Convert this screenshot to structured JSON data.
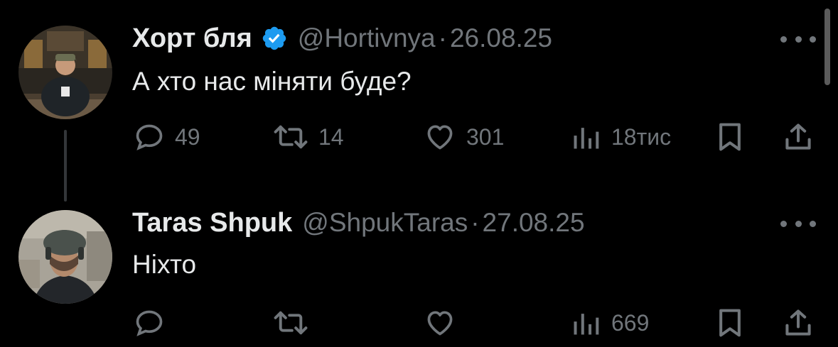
{
  "tweets": [
    {
      "display_name": "Хорт бля",
      "verified": true,
      "handle": "@Hortivnya",
      "separator": "·",
      "date": "26.08.25",
      "text": "А хто нас міняти буде?",
      "actions": {
        "replies": "49",
        "retweets": "14",
        "likes": "301",
        "views": "18тис"
      }
    },
    {
      "display_name": "Taras Shpuk",
      "verified": false,
      "handle": "@ShpukTaras",
      "separator": "·",
      "date": "27.08.25",
      "text": "Ніхто",
      "actions": {
        "replies": "",
        "retweets": "",
        "likes": "",
        "views": "669"
      }
    }
  ],
  "icons": {
    "reply": "reply-icon",
    "retweet": "retweet-icon",
    "like": "heart-icon",
    "views": "views-icon",
    "bookmark": "bookmark-icon",
    "share": "share-icon",
    "more": "more-icon",
    "verified": "verified-badge-icon"
  },
  "colors": {
    "background": "#000000",
    "primary_text": "#e7e9ea",
    "secondary_text": "#71767b",
    "verified_blue": "#1d9bf0",
    "thread_line": "#333639"
  }
}
